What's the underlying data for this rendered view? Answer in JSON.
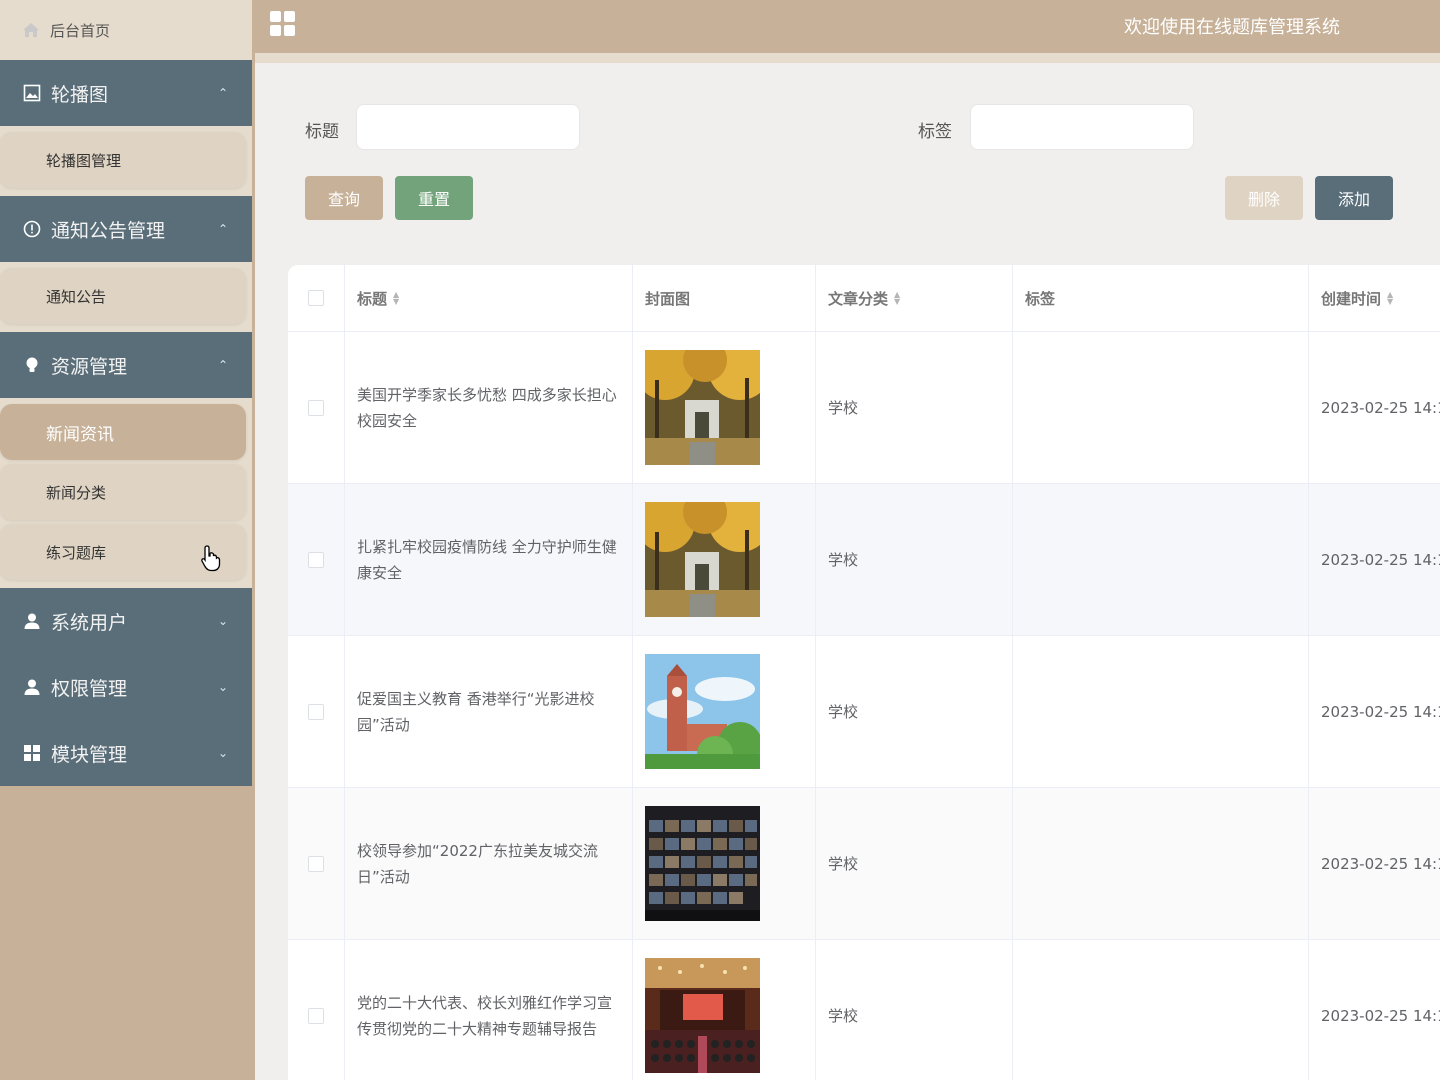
{
  "sidebar": {
    "home_label": "后台首页",
    "groups": [
      {
        "label": "轮播图",
        "icon": "image-icon",
        "expanded": true,
        "items": [
          {
            "label": "轮播图管理",
            "active": false
          }
        ]
      },
      {
        "label": "通知公告管理",
        "icon": "info-circle-icon",
        "expanded": true,
        "items": [
          {
            "label": "通知公告",
            "active": false
          }
        ]
      },
      {
        "label": "资源管理",
        "icon": "lightbulb-icon",
        "expanded": true,
        "items": [
          {
            "label": "新闻资讯",
            "active": true
          },
          {
            "label": "新闻分类",
            "active": false
          },
          {
            "label": "练习题库",
            "active": false
          }
        ]
      },
      {
        "label": "系统用户",
        "icon": "user-icon",
        "expanded": false,
        "items": []
      },
      {
        "label": "权限管理",
        "icon": "user-icon",
        "expanded": false,
        "items": []
      },
      {
        "label": "模块管理",
        "icon": "grid-icon",
        "expanded": false,
        "items": []
      }
    ]
  },
  "header": {
    "title": "欢迎使用在线题库管理系统"
  },
  "search": {
    "title_label": "标题",
    "title_value": "",
    "tag_label": "标签",
    "tag_value": ""
  },
  "toolbar": {
    "query_label": "查询",
    "reset_label": "重置",
    "delete_label": "删除",
    "add_label": "添加"
  },
  "table": {
    "columns": [
      "标题",
      "封面图",
      "文章分类",
      "标签",
      "创建时间"
    ],
    "rows": [
      {
        "title": "美国开学季家长多忧愁 四成多家长担心校园安全",
        "image": "campus-autumn-gate",
        "category": "学校",
        "tag": "",
        "created": "2023-02-25 14:1"
      },
      {
        "title": "扎紧扎牢校园疫情防线 全力守护师生健康安全",
        "image": "campus-autumn-gate",
        "category": "学校",
        "tag": "",
        "created": "2023-02-25 14:1"
      },
      {
        "title": "促爱国主义教育 香港举行“光影进校园”活动",
        "image": "clock-tower-sky",
        "category": "学校",
        "tag": "",
        "created": "2023-02-25 14:1"
      },
      {
        "title": "校领导参加“2022广东拉美友城交流日”活动",
        "image": "video-conference",
        "category": "学校",
        "tag": "",
        "created": "2023-02-25 14:1"
      },
      {
        "title": "党的二十大代表、校长刘雅红作学习宣传贯彻党的二十大精神专题辅导报告",
        "image": "auditorium",
        "category": "学校",
        "tag": "",
        "created": "2023-02-25 14:1"
      }
    ]
  },
  "colors": {
    "sidebar_bg": "#c7b198",
    "group_bg": "#596e79",
    "submenu_bg": "#dfd3c3",
    "query_btn": "#c7b198",
    "reset_btn": "#72a37a",
    "delete_btn": "#dfd3c3",
    "add_btn": "#596e79"
  }
}
